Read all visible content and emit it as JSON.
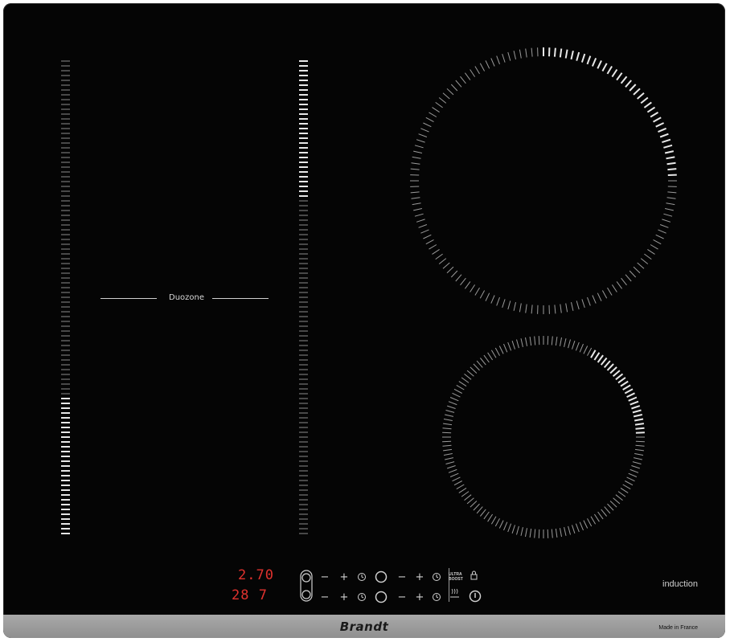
{
  "hob": {
    "brand": "Brandt",
    "made_in": "Made in France",
    "type_label": "induction",
    "zone_label": "Duozone"
  },
  "displays": {
    "row1": "2.70",
    "row2": "28 7"
  },
  "controls": {
    "minus": "−",
    "plus": "+",
    "ultra_boost_line1": "ULTRA",
    "ultra_boost_line2": "BOOST"
  },
  "colors": {
    "glass": "#050505",
    "display_red": "#e0322e",
    "marking": "#d0d0d0",
    "frame": "#9a9a9a"
  }
}
